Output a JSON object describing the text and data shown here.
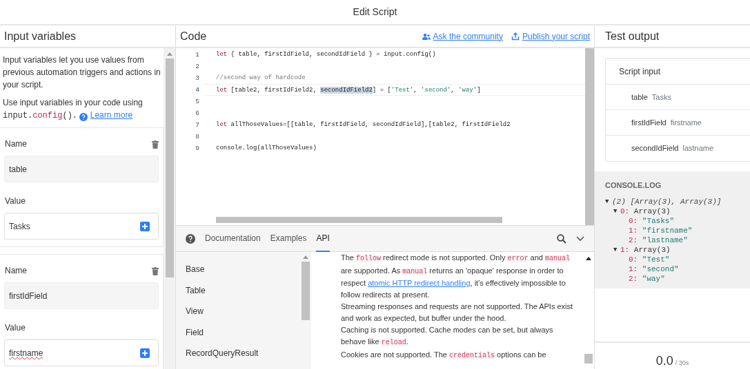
{
  "window": {
    "title": "Edit Script"
  },
  "input_panel": {
    "title": "Input variables",
    "intro": "Input variables let you use values from previous automation triggers and actions in your script.",
    "usage_text": "Use input variables in your code using",
    "usage_code": [
      {
        "kind": "plain",
        "text": "input."
      },
      {
        "kind": "key",
        "text": "config"
      },
      {
        "kind": "plain",
        "text": "()."
      }
    ],
    "learn_more": "Learn more",
    "variables": [
      {
        "name_label": "Name",
        "name": "table",
        "value_label": "Value",
        "value": "Tasks",
        "misspelled": false
      },
      {
        "name_label": "Name",
        "name": "firstIdField",
        "value_label": "Value",
        "value": "firstname",
        "misspelled": true
      }
    ]
  },
  "code_panel": {
    "title": "Code",
    "links": [
      "Ask the community",
      "Publish your script"
    ],
    "lines": [
      {
        "number": "1",
        "current": false,
        "tokens": [
          {
            "kind": "keyword",
            "text": "let"
          },
          {
            "kind": "plain",
            "text": " { table, firstIdField, secondIdField } = input.config()"
          }
        ]
      },
      {
        "number": "2",
        "current": false
      },
      {
        "number": "3",
        "current": false,
        "tokens": [
          {
            "kind": "comment",
            "text": "//second way of hardcode"
          }
        ]
      },
      {
        "number": "4",
        "current": true,
        "tokens": [
          {
            "kind": "keyword",
            "text": "let"
          },
          {
            "kind": "plain",
            "text": " [table2, firstIdField2, "
          },
          {
            "kind": "selected",
            "text": "secondIdField2"
          },
          {
            "kind": "plain",
            "text": "] = ["
          },
          {
            "kind": "string",
            "text": "'Test'"
          },
          {
            "kind": "plain",
            "text": ", "
          },
          {
            "kind": "string",
            "text": "'second'"
          },
          {
            "kind": "plain",
            "text": ", "
          },
          {
            "kind": "string",
            "text": "'way'"
          },
          {
            "kind": "plain",
            "text": "]"
          }
        ]
      },
      {
        "number": "5",
        "current": false
      },
      {
        "number": "6",
        "current": false
      },
      {
        "number": "7",
        "current": false,
        "tokens": [
          {
            "kind": "keyword",
            "text": "let"
          },
          {
            "kind": "plain",
            "text": " allThoseValues=[[table, firstIdField, secondIdField],[table2, firstIdField2"
          }
        ]
      },
      {
        "number": "8",
        "current": false
      },
      {
        "number": "9",
        "current": false,
        "tokens": [
          {
            "kind": "plain",
            "text": "console.log(allThoseValues)"
          }
        ]
      }
    ]
  },
  "docs": {
    "tabs": [
      {
        "label": "Documentation",
        "selected": false
      },
      {
        "label": "Examples",
        "selected": false
      },
      {
        "label": "API",
        "selected": true
      }
    ],
    "sections": [
      "Base",
      "Table",
      "View",
      "Field",
      "RecordQueryResult"
    ],
    "paragraphs": [
      [
        {
          "kind": "text",
          "text": "The "
        },
        {
          "kind": "code",
          "text": "follow"
        },
        {
          "kind": "text",
          "text": " redirect mode is not supported. Only "
        },
        {
          "kind": "code",
          "text": "error"
        },
        {
          "kind": "text",
          "text": " and "
        },
        {
          "kind": "code",
          "text": "manual"
        },
        {
          "kind": "text",
          "text": " are supported. As "
        },
        {
          "kind": "code",
          "text": "manual"
        },
        {
          "kind": "text",
          "text": " returns an 'opaque' response in order to respect "
        },
        {
          "kind": "link",
          "text": "atomic HTTP redirect handling"
        },
        {
          "kind": "text",
          "text": ", it's effectively impossible to follow redirects at present."
        }
      ],
      [
        {
          "kind": "text",
          "text": "Streaming responses and requests are not supported. The APIs exist and work as expected, but buffer under the hood."
        }
      ],
      [
        {
          "kind": "text",
          "text": "Caching is not supported. Cache modes can be set, but always behave like "
        },
        {
          "kind": "code",
          "text": "reload"
        },
        {
          "kind": "text",
          "text": "."
        }
      ],
      [
        {
          "kind": "text",
          "text": "Cookies are not supported. The "
        },
        {
          "kind": "code",
          "text": "credentials"
        },
        {
          "kind": "text",
          "text": " options can be"
        }
      ]
    ]
  },
  "test_output": {
    "title": "Test output",
    "script_input": {
      "title": "Script input",
      "rows": [
        {
          "key": "table",
          "value": "Tasks"
        },
        {
          "key": "firstIdField",
          "value": "firstname"
        },
        {
          "key": "secondIdField",
          "value": "lastname"
        }
      ]
    },
    "console": {
      "title": "CONSOLE.LOG",
      "entries": [
        {
          "toggle": "▼",
          "value": "(2) [Array(3), Array(3)]",
          "children": [
            {
              "toggle": "▼",
              "key": "0:",
              "value": "Array(3)",
              "children": [
                {
                  "key": "0:",
                  "value": "\"Tasks\""
                },
                {
                  "key": "1:",
                  "value": "\"firstname\""
                },
                {
                  "key": "2:",
                  "value": "\"lastname\""
                }
              ]
            },
            {
              "toggle": "▼",
              "key": "1:",
              "value": "Array(3)",
              "children": [
                {
                  "key": "0:",
                  "value": "\"Test\""
                },
                {
                  "key": "1:",
                  "value": "\"second\""
                },
                {
                  "key": "2:",
                  "value": "\"way\""
                }
              ]
            }
          ]
        }
      ]
    },
    "timer": {
      "elapsed": "0.0",
      "limit": "/ 30s"
    }
  }
}
